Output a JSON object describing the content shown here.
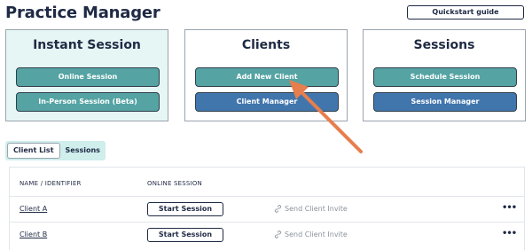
{
  "header": {
    "title": "Practice Manager",
    "quickstart_label": "Quickstart guide"
  },
  "cards": {
    "instant": {
      "title": "Instant Session",
      "btn1": "Online Session",
      "btn2": "In-Person Session (Beta)"
    },
    "clients": {
      "title": "Clients",
      "btn1": "Add New Client",
      "btn2": "Client Manager"
    },
    "sessions": {
      "title": "Sessions",
      "btn1": "Schedule Session",
      "btn2": "Session Manager"
    }
  },
  "tabs": [
    "Client List",
    "Sessions"
  ],
  "table": {
    "headers": [
      "NAME / IDENTIFIER",
      "ONLINE SESSION"
    ],
    "rows": [
      {
        "name": "Client A",
        "action": "Start Session",
        "invite": "Send Client Invite",
        "more": "•••"
      },
      {
        "name": "Client B",
        "action": "Start Session",
        "invite": "Send Client Invite",
        "more": "•••"
      }
    ]
  },
  "colors": {
    "teal": "#55a3a3",
    "blue": "#4176ad",
    "arrow": "#e67e4d",
    "instant_bg": "#e6f6f5"
  }
}
